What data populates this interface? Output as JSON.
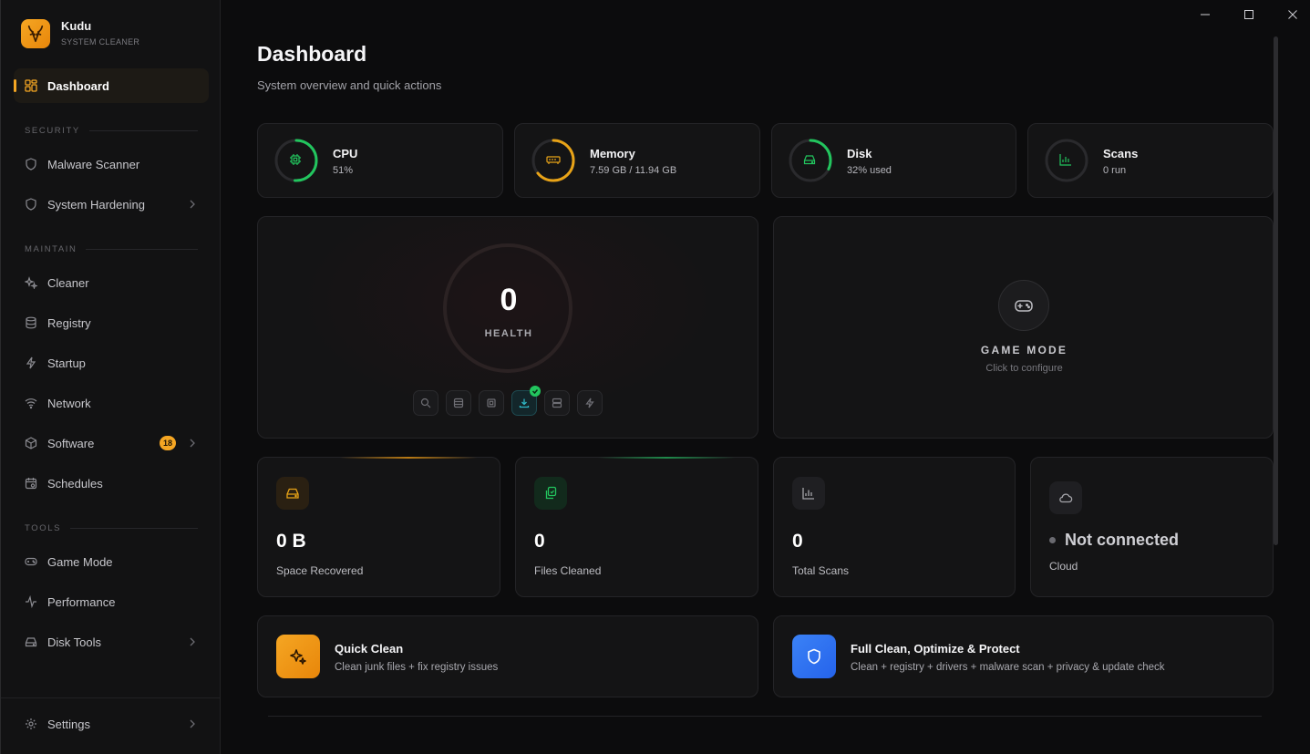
{
  "brand": {
    "name": "Kudu",
    "subtitle": "SYSTEM CLEANER"
  },
  "sidebar": {
    "active": {
      "label": "Dashboard",
      "icon": "grid-icon"
    },
    "sections": {
      "security": "SECURITY",
      "maintain": "MAINTAIN",
      "tools": "TOOLS"
    },
    "items": [
      {
        "label": "Malware Scanner",
        "icon": "shield-icon"
      },
      {
        "label": "System Hardening",
        "icon": "shield-icon"
      },
      {
        "label": "Cleaner",
        "icon": "sparkles-icon"
      },
      {
        "label": "Registry",
        "icon": "database-icon"
      },
      {
        "label": "Startup",
        "icon": "bolt-icon"
      },
      {
        "label": "Network",
        "icon": "wifi-icon"
      },
      {
        "label": "Software",
        "icon": "box-icon",
        "badge": "18"
      },
      {
        "label": "Schedules",
        "icon": "calendar-icon"
      },
      {
        "label": "Game Mode",
        "icon": "gamepad-icon"
      },
      {
        "label": "Performance",
        "icon": "pulse-icon"
      },
      {
        "label": "Disk Tools",
        "icon": "drive-icon"
      }
    ],
    "settings": {
      "label": "Settings",
      "icon": "gear-icon"
    }
  },
  "header": {
    "title": "Dashboard",
    "subtitle": "System overview and quick actions"
  },
  "stats": [
    {
      "title": "CPU",
      "value": "51%",
      "fraction": 0.51,
      "color": "#22c55e"
    },
    {
      "title": "Memory",
      "value": "7.59 GB / 11.94 GB",
      "fraction": 0.64,
      "color": "#e8a317"
    },
    {
      "title": "Disk",
      "value": "32% used",
      "fraction": 0.32,
      "color": "#22c55e"
    },
    {
      "title": "Scans",
      "value": "0 run",
      "fraction": 0,
      "color": "#22c55e"
    }
  ],
  "health": {
    "score": "0",
    "label": "HEALTH"
  },
  "game_mode": {
    "title": "GAME MODE",
    "subtitle": "Click to configure"
  },
  "metrics": [
    {
      "value": "0 B",
      "label": "Space Recovered"
    },
    {
      "value": "0",
      "label": "Files Cleaned"
    },
    {
      "value": "0",
      "label": "Total Scans"
    },
    {
      "value": "Not connected",
      "label": "Cloud"
    }
  ],
  "actions": [
    {
      "title": "Quick Clean",
      "subtitle": "Clean junk files + fix registry issues"
    },
    {
      "title": "Full Clean, Optimize & Protect",
      "subtitle": "Clean + registry + drivers + malware scan + privacy & update check"
    }
  ],
  "colors": {
    "accent": "#f5a623",
    "success": "#22c55e",
    "blue": "#3b82f6"
  }
}
